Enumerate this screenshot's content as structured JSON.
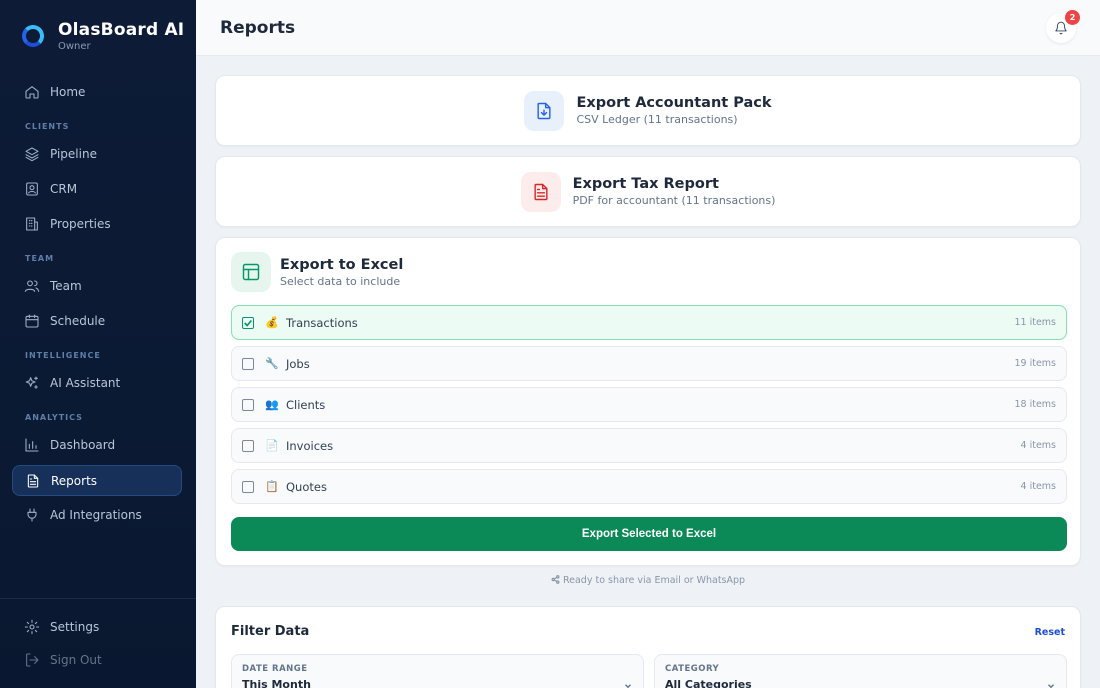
{
  "app": {
    "name": "OlasBoard AI",
    "role": "Owner"
  },
  "sidebar": {
    "home": "Home",
    "section_clients": "CLIENTS",
    "pipeline": "Pipeline",
    "crm": "CRM",
    "properties": "Properties",
    "section_team": "TEAM",
    "team": "Team",
    "schedule": "Schedule",
    "section_intelligence": "INTELLIGENCE",
    "ai_assistant": "AI Assistant",
    "section_analytics": "ANALYTICS",
    "dashboard": "Dashboard",
    "reports": "Reports",
    "ad_integrations": "Ad Integrations",
    "settings": "Settings",
    "sign_out": "Sign Out"
  },
  "header": {
    "title": "Reports",
    "notification_count": "2"
  },
  "accountant_pack": {
    "title": "Export Accountant Pack",
    "subtitle": "CSV Ledger (11 transactions)"
  },
  "tax_report": {
    "title": "Export Tax Report",
    "subtitle": "PDF for accountant (11 transactions)"
  },
  "excel": {
    "title": "Export to Excel",
    "subtitle": "Select data to include",
    "rows": [
      {
        "emoji": "💰",
        "label": "Transactions",
        "count": "11 items",
        "checked": true
      },
      {
        "emoji": "🔧",
        "label": "Jobs",
        "count": "19 items",
        "checked": false
      },
      {
        "emoji": "👥",
        "label": "Clients",
        "count": "18 items",
        "checked": false
      },
      {
        "emoji": "📄",
        "label": "Invoices",
        "count": "4 items",
        "checked": false
      },
      {
        "emoji": "📋",
        "label": "Quotes",
        "count": "4 items",
        "checked": false
      }
    ],
    "button": "Export Selected to Excel"
  },
  "share_note": "Ready to share via Email or WhatsApp",
  "filter": {
    "title": "Filter Data",
    "reset": "Reset",
    "date_label": "DATE RANGE",
    "date_value": "This Month",
    "category_label": "CATEGORY",
    "category_value": "All Categories"
  },
  "colors": {
    "sidebar_bg": "#0d1b36",
    "primary_green": "#0b8a57",
    "accent_blue": "#2563eb",
    "badge_red": "#ef4444"
  }
}
